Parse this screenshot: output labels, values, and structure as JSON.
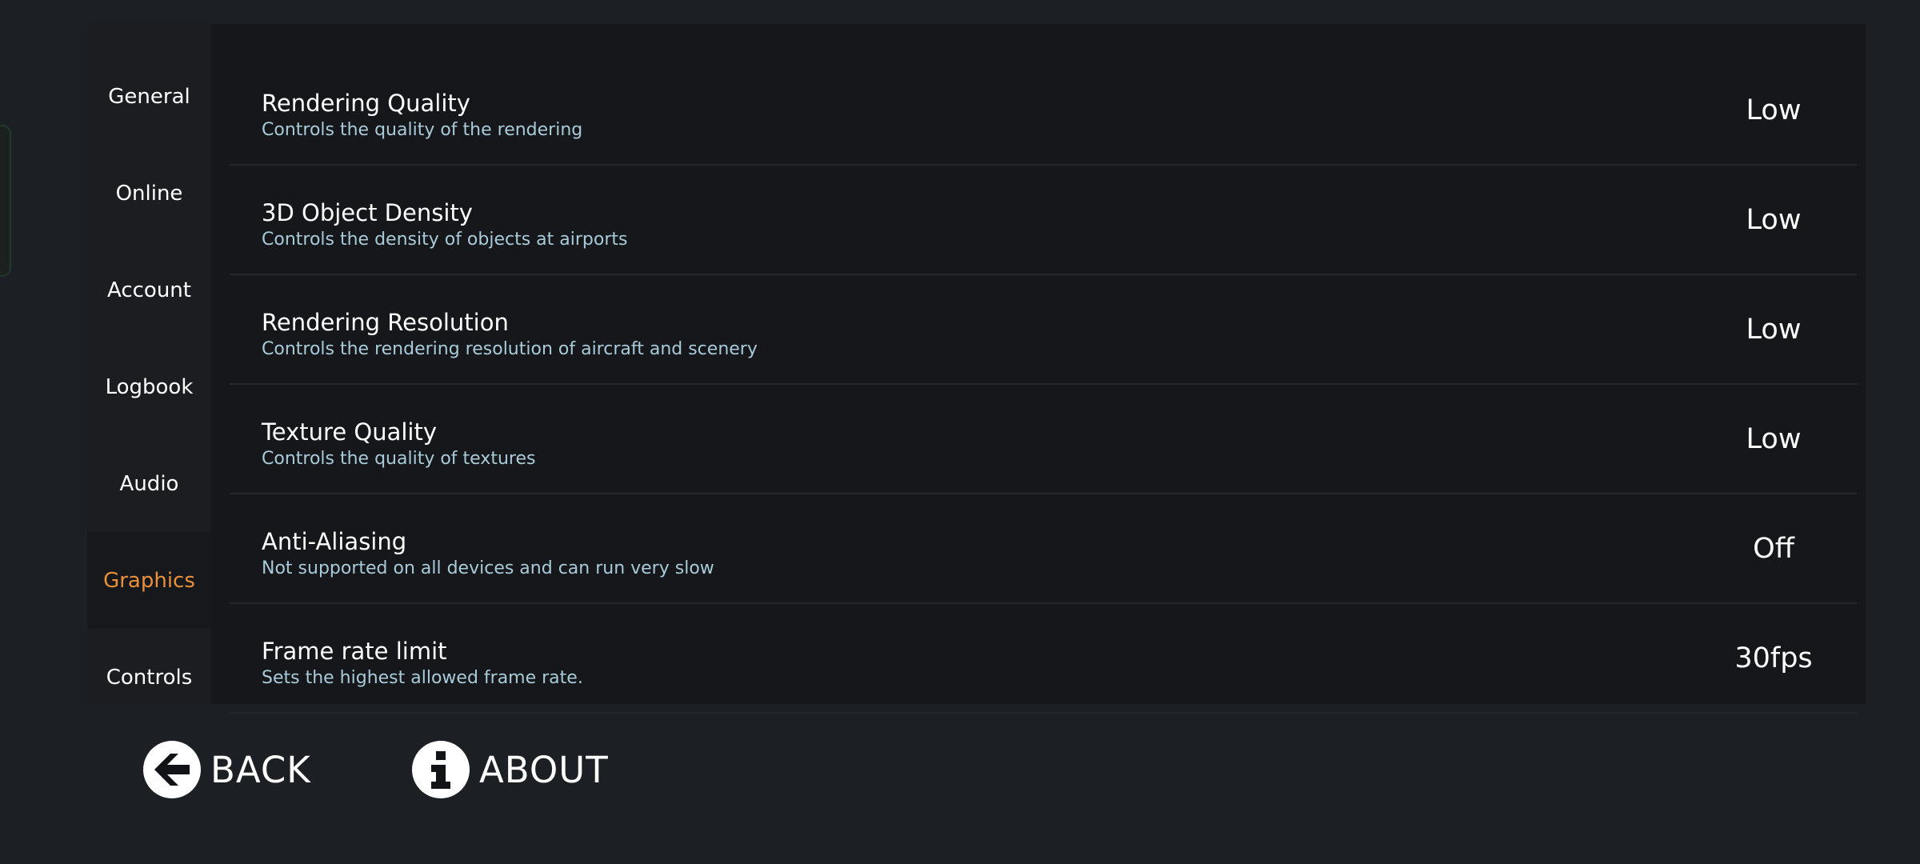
{
  "sidebar": {
    "items": [
      {
        "label": "General"
      },
      {
        "label": "Online"
      },
      {
        "label": "Account"
      },
      {
        "label": "Logbook"
      },
      {
        "label": "Audio"
      },
      {
        "label": "Graphics",
        "active": true
      },
      {
        "label": "Controls"
      }
    ]
  },
  "settings": [
    {
      "title": "Rendering Quality",
      "description": "Controls the quality of the rendering",
      "value": "Low"
    },
    {
      "title": "3D Object Density",
      "description": "Controls the density of objects at airports",
      "value": "Low"
    },
    {
      "title": "Rendering Resolution",
      "description": "Controls the rendering resolution of aircraft and scenery",
      "value": "Low"
    },
    {
      "title": "Texture Quality",
      "description": "Controls the quality of textures",
      "value": "Low"
    },
    {
      "title": "Anti-Aliasing",
      "description": "Not supported on all devices and can run very slow",
      "value": "Off"
    },
    {
      "title": "Frame rate limit",
      "description": "Sets the highest allowed frame rate.",
      "value": "30fps"
    }
  ],
  "footer": {
    "back_label": "BACK",
    "back_icon": "arrow-left-circle-icon",
    "about_label": "ABOUT",
    "about_icon": "info-circle-icon"
  },
  "colors": {
    "background": "#1c1f23",
    "panel": "#15171a",
    "active_tab": "#e8903a",
    "description": "#a9cbd9"
  }
}
